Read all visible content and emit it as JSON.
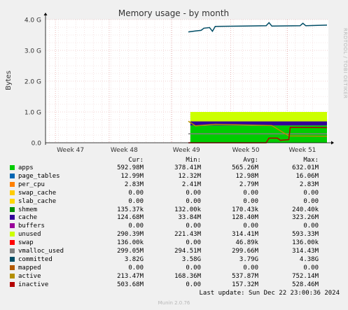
{
  "chart_data": {
    "type": "area",
    "title": "Memory usage - by month",
    "ylabel": "Bytes",
    "xlabel": "",
    "ylim": [
      0,
      4.0
    ],
    "y_unit": "G",
    "y_ticks": [
      "0.0",
      "1.0 G",
      "2.0 G",
      "3.0 G",
      "4.0 G"
    ],
    "x_ticks": [
      "Week 47",
      "Week 48",
      "Week 49",
      "Week 50",
      "Week 51"
    ],
    "grid": true,
    "legend_columns": [
      "Cur:",
      "Min:",
      "Avg:",
      "Max:"
    ],
    "series": [
      {
        "name": "apps",
        "color": "#00cc00",
        "cur": "592.98M",
        "min": "378.41M",
        "avg": "565.26M",
        "max": "632.01M"
      },
      {
        "name": "page_tables",
        "color": "#0066b3",
        "cur": "12.99M",
        "min": "12.32M",
        "avg": "12.98M",
        "max": "16.06M"
      },
      {
        "name": "per_cpu",
        "color": "#ff8000",
        "cur": "2.83M",
        "min": "2.41M",
        "avg": "2.79M",
        "max": "2.83M"
      },
      {
        "name": "swap_cache",
        "color": "#ffcc00",
        "cur": "0.00",
        "min": "0.00",
        "avg": "0.00",
        "max": "0.00"
      },
      {
        "name": "slab_cache",
        "color": "#ffd700",
        "cur": "0.00",
        "min": "0.00",
        "avg": "0.00",
        "max": "0.00"
      },
      {
        "name": "shmem",
        "color": "#008f00",
        "cur": "135.37k",
        "min": "132.00k",
        "avg": "170.43k",
        "max": "240.40k"
      },
      {
        "name": "cache",
        "color": "#330099",
        "cur": "124.68M",
        "min": "33.84M",
        "avg": "128.40M",
        "max": "323.26M"
      },
      {
        "name": "buffers",
        "color": "#990099",
        "cur": "0.00",
        "min": "0.00",
        "avg": "0.00",
        "max": "0.00"
      },
      {
        "name": "unused",
        "color": "#ccff00",
        "cur": "290.39M",
        "min": "221.43M",
        "avg": "314.41M",
        "max": "593.33M"
      },
      {
        "name": "swap",
        "color": "#ff0000",
        "cur": "136.00k",
        "min": "0.00",
        "avg": "46.89k",
        "max": "136.00k"
      },
      {
        "name": "vmalloc_used",
        "color": "#808080",
        "cur": "299.05M",
        "min": "294.51M",
        "avg": "299.66M",
        "max": "314.43M"
      },
      {
        "name": "committed",
        "color": "#004d66",
        "cur": "3.82G",
        "min": "3.58G",
        "avg": "3.79G",
        "max": "4.38G"
      },
      {
        "name": "mapped",
        "color": "#b35a00",
        "cur": "0.00",
        "min": "0.00",
        "avg": "0.00",
        "max": "0.00"
      },
      {
        "name": "active",
        "color": "#b38f00",
        "cur": "213.47M",
        "min": "168.36M",
        "avg": "537.87M",
        "max": "752.14M"
      },
      {
        "name": "inactive",
        "color": "#b30000",
        "cur": "503.68M",
        "min": "0.00",
        "avg": "157.32M",
        "max": "528.46M"
      }
    ]
  },
  "last_update": "Last update: Sun Dec 22 23:00:36 2024",
  "munin_version": "Munin 2.0.76",
  "rrd_credit": "RRDTOOL / TOBI OETIKER"
}
